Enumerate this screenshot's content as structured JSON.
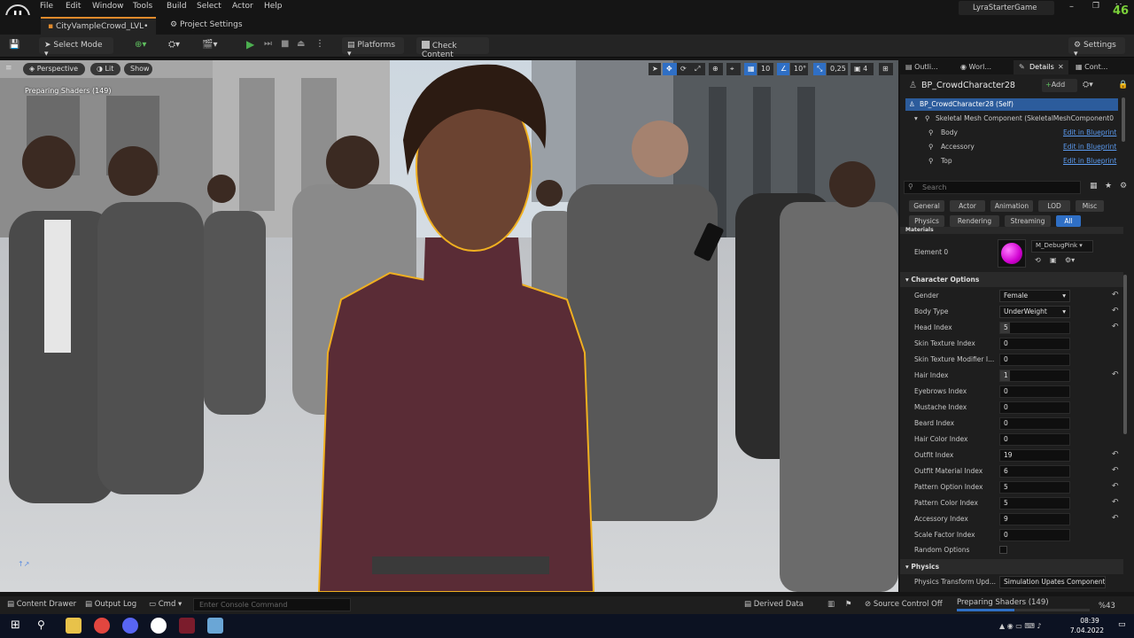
{
  "menu": [
    "File",
    "Edit",
    "Window",
    "Tools",
    "Build",
    "Select",
    "Actor",
    "Help"
  ],
  "project_name": "LyraStarterGame",
  "fps": "46",
  "tabs": {
    "level": "CityVampleCrowd_LVL•",
    "settings": "Project Settings"
  },
  "toolbar": {
    "mode": "Select Mode",
    "platforms": "Platforms",
    "check": "Check Content",
    "settings": "Settings"
  },
  "viewport": {
    "perspective": "Perspective",
    "lit": "Lit",
    "show": "Show",
    "status": "Preparing Shaders (149)",
    "grid": "10",
    "angle": "10°",
    "scale": "0,25",
    "cam": "4"
  },
  "panel_tabs": [
    "Outli...",
    "Worl...",
    "Details",
    "Cont..."
  ],
  "details": {
    "actor": "BP_CrowdCharacter28",
    "add": "Add",
    "self": "BP_CrowdCharacter28 (Self)",
    "component": "Skeletal Mesh Component (SkeletalMeshComponent0",
    "children": [
      {
        "name": "Body",
        "link": "Edit in Blueprint"
      },
      {
        "name": "Accessory",
        "link": "Edit in Blueprint"
      },
      {
        "name": "Top",
        "link": "Edit in Blueprint"
      }
    ],
    "search_placeholder": "Search",
    "filters1": [
      "General",
      "Actor",
      "Animation",
      "LOD",
      "Misc"
    ],
    "filters2": [
      "Physics",
      "Rendering",
      "Streaming",
      "All"
    ],
    "materials_label": "Materials",
    "element_label": "Element 0",
    "material_name": "M_DebugPink",
    "material_color": "#d000d0",
    "cat_character": "Character Options",
    "props": [
      {
        "label": "Gender",
        "value": "Female",
        "type": "dropdown"
      },
      {
        "label": "Body Type",
        "value": "UnderWeight",
        "type": "dropdown"
      },
      {
        "label": "Head Index",
        "value": "5",
        "type": "slider"
      },
      {
        "label": "Skin Texture Index",
        "value": "0",
        "type": "field"
      },
      {
        "label": "Skin Texture Modifier I...",
        "value": "0",
        "type": "field"
      },
      {
        "label": "Hair Index",
        "value": "1",
        "type": "slider"
      },
      {
        "label": "Eyebrows Index",
        "value": "0",
        "type": "field"
      },
      {
        "label": "Mustache Index",
        "value": "0",
        "type": "field"
      },
      {
        "label": "Beard Index",
        "value": "0",
        "type": "field"
      },
      {
        "label": "Hair Color Index",
        "value": "0",
        "type": "field"
      },
      {
        "label": "Outfit Index",
        "value": "19",
        "type": "field"
      },
      {
        "label": "Outfit Material Index",
        "value": "6",
        "type": "field"
      },
      {
        "label": "Pattern Option Index",
        "value": "5",
        "type": "field"
      },
      {
        "label": "Pattern Color Index",
        "value": "5",
        "type": "field"
      },
      {
        "label": "Accessory Index",
        "value": "9",
        "type": "field"
      },
      {
        "label": "Scale Factor Index",
        "value": "0",
        "type": "field"
      }
    ],
    "random_label": "Random Options",
    "cat_physics": "Physics",
    "physics_label": "Physics Transform Upd...",
    "physics_value": "Simulation Upates Component"
  },
  "bottom": {
    "drawer": "Content Drawer",
    "log": "Output Log",
    "cmd": "Cmd",
    "cmd_placeholder": "Enter Console Command",
    "derived": "Derived Data",
    "source": "Source Control Off",
    "shaders": "Preparing Shaders (149)",
    "percent": "%43",
    "shader_progress": 0.43
  },
  "taskbar": {
    "time": "08:39",
    "date": "7.04.2022"
  },
  "colors": {
    "accent": "#2f6fc5",
    "selection_outline": "#f0b020",
    "play_green": "#4caf50"
  }
}
